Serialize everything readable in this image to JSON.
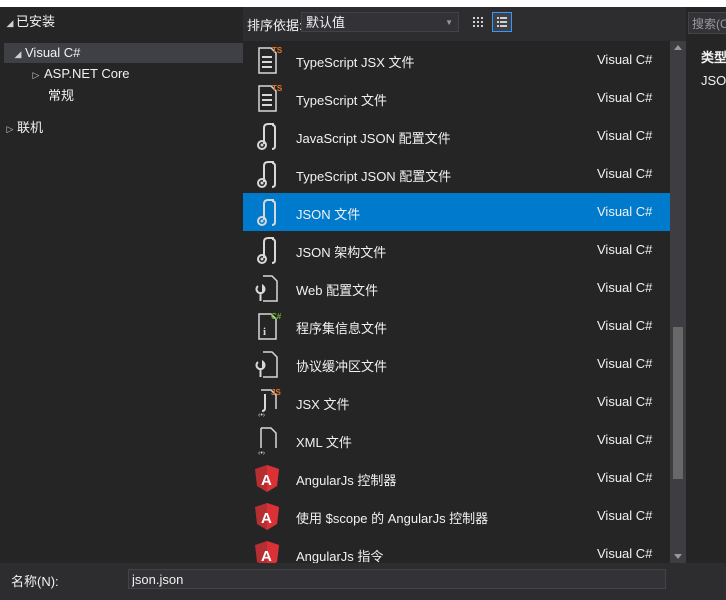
{
  "tree": {
    "installed": "已安装",
    "visual_csharp": "Visual C#",
    "aspnet_core": "ASP.NET Core",
    "common": "常规",
    "online": "联机"
  },
  "toolbar": {
    "sort_label": "排序依据:",
    "sort_value": "默认值"
  },
  "templates": [
    {
      "name": "TypeScript JSX 文件",
      "lang": "Visual C#",
      "icon": "typescript-jsx-file-icon"
    },
    {
      "name": "TypeScript 文件",
      "lang": "Visual C#",
      "icon": "typescript-file-icon"
    },
    {
      "name": "JavaScript JSON 配置文件",
      "lang": "Visual C#",
      "icon": "json-config-icon"
    },
    {
      "name": "TypeScript JSON 配置文件",
      "lang": "Visual C#",
      "icon": "json-config-icon"
    },
    {
      "name": "JSON 文件",
      "lang": "Visual C#",
      "icon": "json-file-icon",
      "selected": true
    },
    {
      "name": "JSON 架构文件",
      "lang": "Visual C#",
      "icon": "json-schema-icon"
    },
    {
      "name": "Web 配置文件",
      "lang": "Visual C#",
      "icon": "web-config-icon"
    },
    {
      "name": "程序集信息文件",
      "lang": "Visual C#",
      "icon": "assembly-info-icon"
    },
    {
      "name": "协议缓冲区文件",
      "lang": "Visual C#",
      "icon": "protobuf-file-icon"
    },
    {
      "name": "JSX 文件",
      "lang": "Visual C#",
      "icon": "jsx-file-icon"
    },
    {
      "name": "XML 文件",
      "lang": "Visual C#",
      "icon": "xml-file-icon"
    },
    {
      "name": "AngularJs 控制器",
      "lang": "Visual C#",
      "icon": "angular-icon"
    },
    {
      "name": "使用 $scope 的 AngularJs 控制器",
      "lang": "Visual C#",
      "icon": "angular-icon"
    },
    {
      "name": "AngularJs 指令",
      "lang": "Visual C#",
      "icon": "angular-icon"
    }
  ],
  "right_panel": {
    "search_placeholder": "搜索(C",
    "type_label": "类型",
    "type_value": "JSON"
  },
  "bottom": {
    "name_label": "名称(N):",
    "name_value": "json.json"
  },
  "colors": {
    "selection": "#007acc",
    "ts_badge": "#e8742a",
    "csharp_badge": "#68b723",
    "angular_red": "#b52e31"
  }
}
